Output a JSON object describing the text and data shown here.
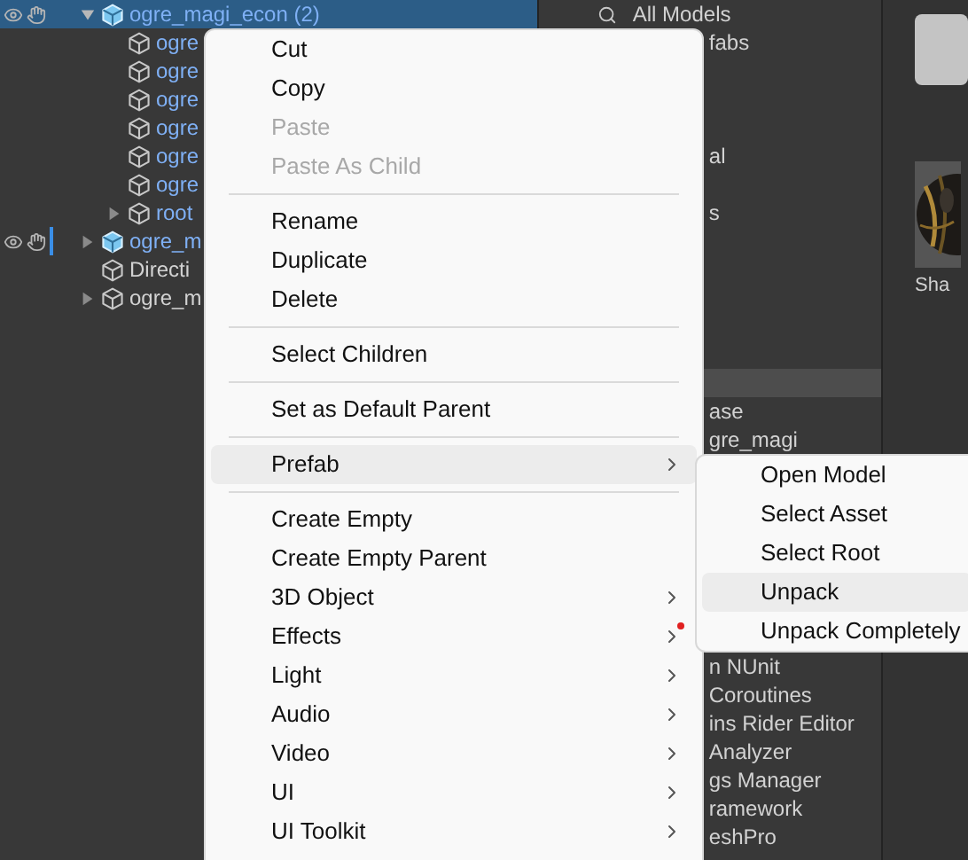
{
  "hierarchy": {
    "rows": [
      {
        "label": "ogre_magi_econ (2)",
        "kind": "prefab",
        "expanded": true,
        "selected": true,
        "scene_icons": true,
        "marked": false,
        "children": [
          {
            "label": "ogre",
            "kind": "prefab-part",
            "selected": false,
            "scene_icons": false,
            "marked": false
          },
          {
            "label": "ogre",
            "kind": "prefab-part",
            "selected": false,
            "scene_icons": false,
            "marked": false
          },
          {
            "label": "ogre",
            "kind": "prefab-part",
            "selected": false,
            "scene_icons": false,
            "marked": false
          },
          {
            "label": "ogre",
            "kind": "prefab-part",
            "selected": false,
            "scene_icons": false,
            "marked": false
          },
          {
            "label": "ogre",
            "kind": "prefab-part",
            "selected": false,
            "scene_icons": false,
            "marked": false
          },
          {
            "label": "ogre",
            "kind": "prefab-part",
            "selected": false,
            "scene_icons": false,
            "marked": false
          },
          {
            "label": "root",
            "kind": "prefab-part",
            "expanded": false,
            "selected": false,
            "scene_icons": false,
            "marked": false
          }
        ]
      },
      {
        "label": "ogre_m",
        "kind": "prefab",
        "expanded": false,
        "selected": false,
        "scene_icons": true,
        "marked": true
      },
      {
        "label": "Directi",
        "kind": "object",
        "selected": false,
        "scene_icons": false,
        "marked": false
      },
      {
        "label": "ogre_m",
        "kind": "object",
        "expanded": false,
        "selected": false,
        "scene_icons": false,
        "marked": false
      }
    ]
  },
  "project": {
    "rows": [
      {
        "text": "All Models",
        "kind": "search",
        "selected": false
      },
      {
        "text": "fabs",
        "kind": "folder",
        "selected": false
      },
      {
        "text": "al",
        "kind": "folder",
        "selected": false
      },
      {
        "text": "s",
        "kind": "folder",
        "selected": false
      },
      {
        "kind": "folder",
        "selected": true
      },
      {
        "text": "ase",
        "kind": "folder",
        "selected": false
      },
      {
        "text": "gre_magi",
        "kind": "folder",
        "selected": false
      },
      {
        "text": "n NUnit",
        "kind": "folder",
        "selected": false
      },
      {
        "text": "Coroutines",
        "kind": "folder",
        "selected": false
      },
      {
        "text": "ins Rider Editor",
        "kind": "folder",
        "selected": false
      },
      {
        "text": "Analyzer",
        "kind": "folder",
        "selected": false
      },
      {
        "text": "gs Manager",
        "kind": "folder",
        "selected": false
      },
      {
        "text": "ramework",
        "kind": "folder",
        "selected": false
      },
      {
        "text": "eshPro",
        "kind": "folder",
        "selected": false
      }
    ]
  },
  "assets": {
    "items": [
      {
        "kind": "tile"
      },
      {
        "kind": "picture",
        "label": "Sha"
      }
    ]
  },
  "context_menu": {
    "indicator_dot": true,
    "items": [
      {
        "kind": "item",
        "label": "Cut",
        "disabled": false,
        "submenu": false,
        "selected": false
      },
      {
        "kind": "item",
        "label": "Copy",
        "disabled": false,
        "submenu": false,
        "selected": false
      },
      {
        "kind": "item",
        "label": "Paste",
        "disabled": true,
        "submenu": false,
        "selected": false
      },
      {
        "kind": "item",
        "label": "Paste As Child",
        "disabled": true,
        "submenu": false,
        "selected": false
      },
      {
        "kind": "separator"
      },
      {
        "kind": "item",
        "label": "Rename",
        "disabled": false,
        "submenu": false,
        "selected": false
      },
      {
        "kind": "item",
        "label": "Duplicate",
        "disabled": false,
        "submenu": false,
        "selected": false
      },
      {
        "kind": "item",
        "label": "Delete",
        "disabled": false,
        "submenu": false,
        "selected": false
      },
      {
        "kind": "separator"
      },
      {
        "kind": "item",
        "label": "Select Children",
        "disabled": false,
        "submenu": false,
        "selected": false
      },
      {
        "kind": "separator"
      },
      {
        "kind": "item",
        "label": "Set as Default Parent",
        "disabled": false,
        "submenu": false,
        "selected": false
      },
      {
        "kind": "separator"
      },
      {
        "kind": "item",
        "label": "Prefab",
        "disabled": false,
        "submenu": true,
        "selected": true
      },
      {
        "kind": "separator"
      },
      {
        "kind": "item",
        "label": "Create Empty",
        "disabled": false,
        "submenu": false,
        "selected": false
      },
      {
        "kind": "item",
        "label": "Create Empty Parent",
        "disabled": false,
        "submenu": false,
        "selected": false
      },
      {
        "kind": "item",
        "label": "3D Object",
        "disabled": false,
        "submenu": true,
        "selected": false
      },
      {
        "kind": "item",
        "label": "Effects",
        "disabled": false,
        "submenu": true,
        "selected": false
      },
      {
        "kind": "item",
        "label": "Light",
        "disabled": false,
        "submenu": true,
        "selected": false
      },
      {
        "kind": "item",
        "label": "Audio",
        "disabled": false,
        "submenu": true,
        "selected": false
      },
      {
        "kind": "item",
        "label": "Video",
        "disabled": false,
        "submenu": true,
        "selected": false
      },
      {
        "kind": "item",
        "label": "UI",
        "disabled": false,
        "submenu": true,
        "selected": false
      },
      {
        "kind": "item",
        "label": "UI Toolkit",
        "disabled": false,
        "submenu": true,
        "selected": false
      }
    ]
  },
  "submenu": {
    "items": [
      {
        "label": "Open Model",
        "selected": false
      },
      {
        "label": "Select Asset",
        "selected": false
      },
      {
        "label": "Select Root",
        "selected": false
      },
      {
        "label": "Unpack",
        "selected": true
      },
      {
        "label": "Unpack Completely",
        "selected": false
      }
    ]
  }
}
